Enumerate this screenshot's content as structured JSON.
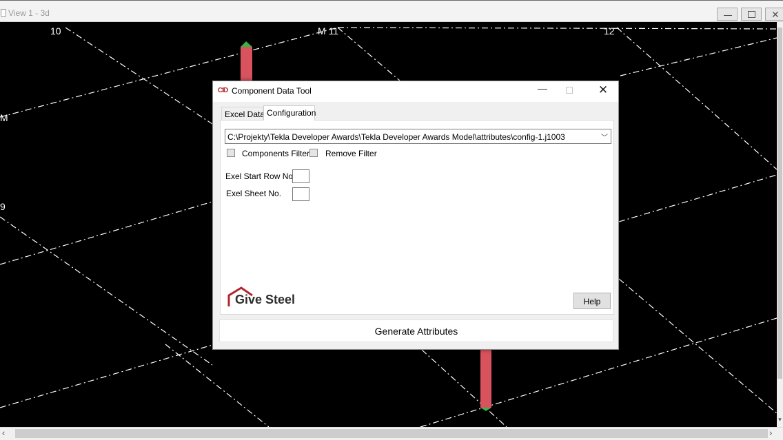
{
  "view_window": {
    "title": "View 1 - 3d",
    "grid_labels": {
      "col_10": "10",
      "col_m11": "M 11",
      "col_12": "12",
      "row_m": "M",
      "row_9": "9"
    },
    "colors": {
      "background": "#000000",
      "grid_line": "#ffffff",
      "column_member": "#d9535f",
      "column_top": "#3cb043"
    }
  },
  "dialog": {
    "title": "Component Data Tool",
    "logo_icon_text": "CID",
    "tabs": [
      {
        "label": "Excel Data",
        "active": false
      },
      {
        "label": "Configuration",
        "active": true
      }
    ],
    "config_path": "C:\\Projekty\\Tekla Developer Awards\\Tekla Developer Awards Model\\attributes\\config-1.j1003",
    "checkboxes": {
      "components_filter": {
        "label": "Components Filter",
        "checked": false
      },
      "remove_filter": {
        "label": "Remove Filter",
        "checked": false
      }
    },
    "fields": {
      "start_row": {
        "label": "Exel Start Row No.",
        "value": ""
      },
      "sheet_no": {
        "label": "Exel Sheet No.",
        "value": ""
      }
    },
    "brand": {
      "name": "Give Steel",
      "color": "#b3262d"
    },
    "help_label": "Help",
    "generate_label": "Generate Attributes"
  }
}
